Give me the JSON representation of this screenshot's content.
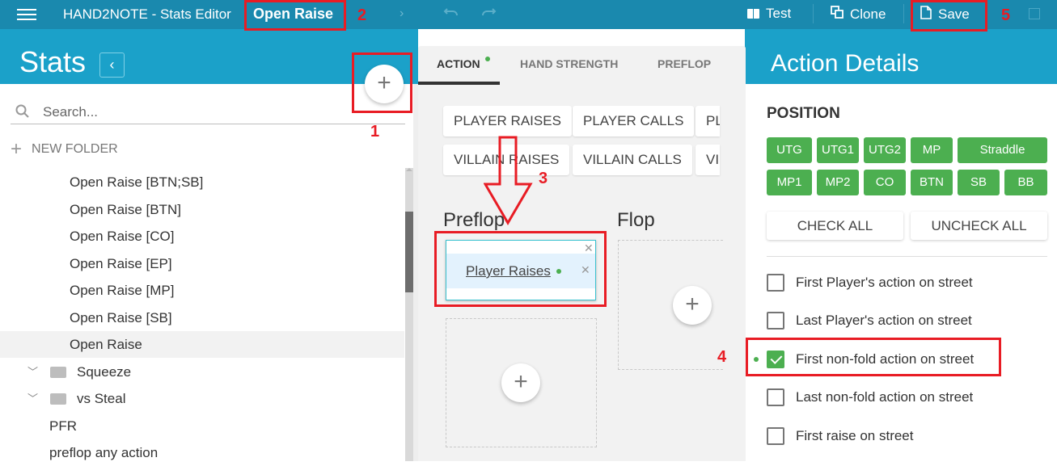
{
  "topbar": {
    "app_title": "HAND2NOTE - Stats Editor",
    "stat_name": "Open Raise",
    "test_label": "Test",
    "clone_label": "Clone",
    "save_label": "Save"
  },
  "sidebar": {
    "title": "Stats",
    "collapse_glyph": "‹",
    "add_glyph": "+",
    "search_placeholder": "Search...",
    "new_folder_label": "NEW FOLDER",
    "items": [
      {
        "label": "Open Raise [BTN;SB]",
        "type": "stat"
      },
      {
        "label": "Open Raise [BTN]",
        "type": "stat"
      },
      {
        "label": "Open Raise [CO]",
        "type": "stat"
      },
      {
        "label": "Open Raise [EP]",
        "type": "stat"
      },
      {
        "label": "Open Raise [MP]",
        "type": "stat"
      },
      {
        "label": "Open Raise [SB]",
        "type": "stat"
      },
      {
        "label": "Open Raise",
        "type": "stat",
        "selected": true
      },
      {
        "label": "Squeeze",
        "type": "folder"
      },
      {
        "label": "vs Steal",
        "type": "folder"
      },
      {
        "label": "PFR",
        "type": "stat"
      },
      {
        "label": "preflop any action",
        "type": "stat"
      }
    ]
  },
  "middle": {
    "tabs": [
      {
        "label": "ACTION",
        "active": true,
        "modified": true
      },
      {
        "label": "HAND STRENGTH",
        "active": false
      },
      {
        "label": "PREFLOP",
        "active": false
      }
    ],
    "action_chips": {
      "row1": [
        "PLAYER RAISES",
        "PLAYER CALLS",
        "PL"
      ],
      "row2": [
        "VILLAIN RAISES",
        "VILLAIN CALLS",
        "VI"
      ]
    },
    "streets": [
      {
        "name": "Preflop",
        "actions": [
          {
            "label": "Player Raises",
            "modified": true
          }
        ]
      },
      {
        "name": "Flop",
        "actions": []
      }
    ],
    "add_glyph": "+",
    "remove_glyph": "✕"
  },
  "details": {
    "title": "Action Details",
    "position_label": "POSITION",
    "positions_row1": [
      "UTG",
      "UTG1",
      "UTG2",
      "MP",
      "Straddle"
    ],
    "positions_row2": [
      "MP1",
      "MP2",
      "CO",
      "BTN",
      "SB",
      "BB"
    ],
    "check_all_label": "CHECK ALL",
    "uncheck_all_label": "UNCHECK ALL",
    "options": [
      {
        "label": "First Player's action on street",
        "checked": false
      },
      {
        "label": "Last Player's action on street",
        "checked": false
      },
      {
        "label": "First non-fold action on street",
        "checked": true
      },
      {
        "label": "Last non-fold action on street",
        "checked": false
      },
      {
        "label": "First raise on street",
        "checked": false
      }
    ],
    "accent_color": "#4caf50"
  },
  "annotations": [
    "1",
    "2",
    "3",
    "4",
    "5"
  ],
  "colors": {
    "topbar": "#1a89ae",
    "header": "#1ba1c9",
    "annotation": "#e81c24",
    "position_green": "#4caf50"
  }
}
